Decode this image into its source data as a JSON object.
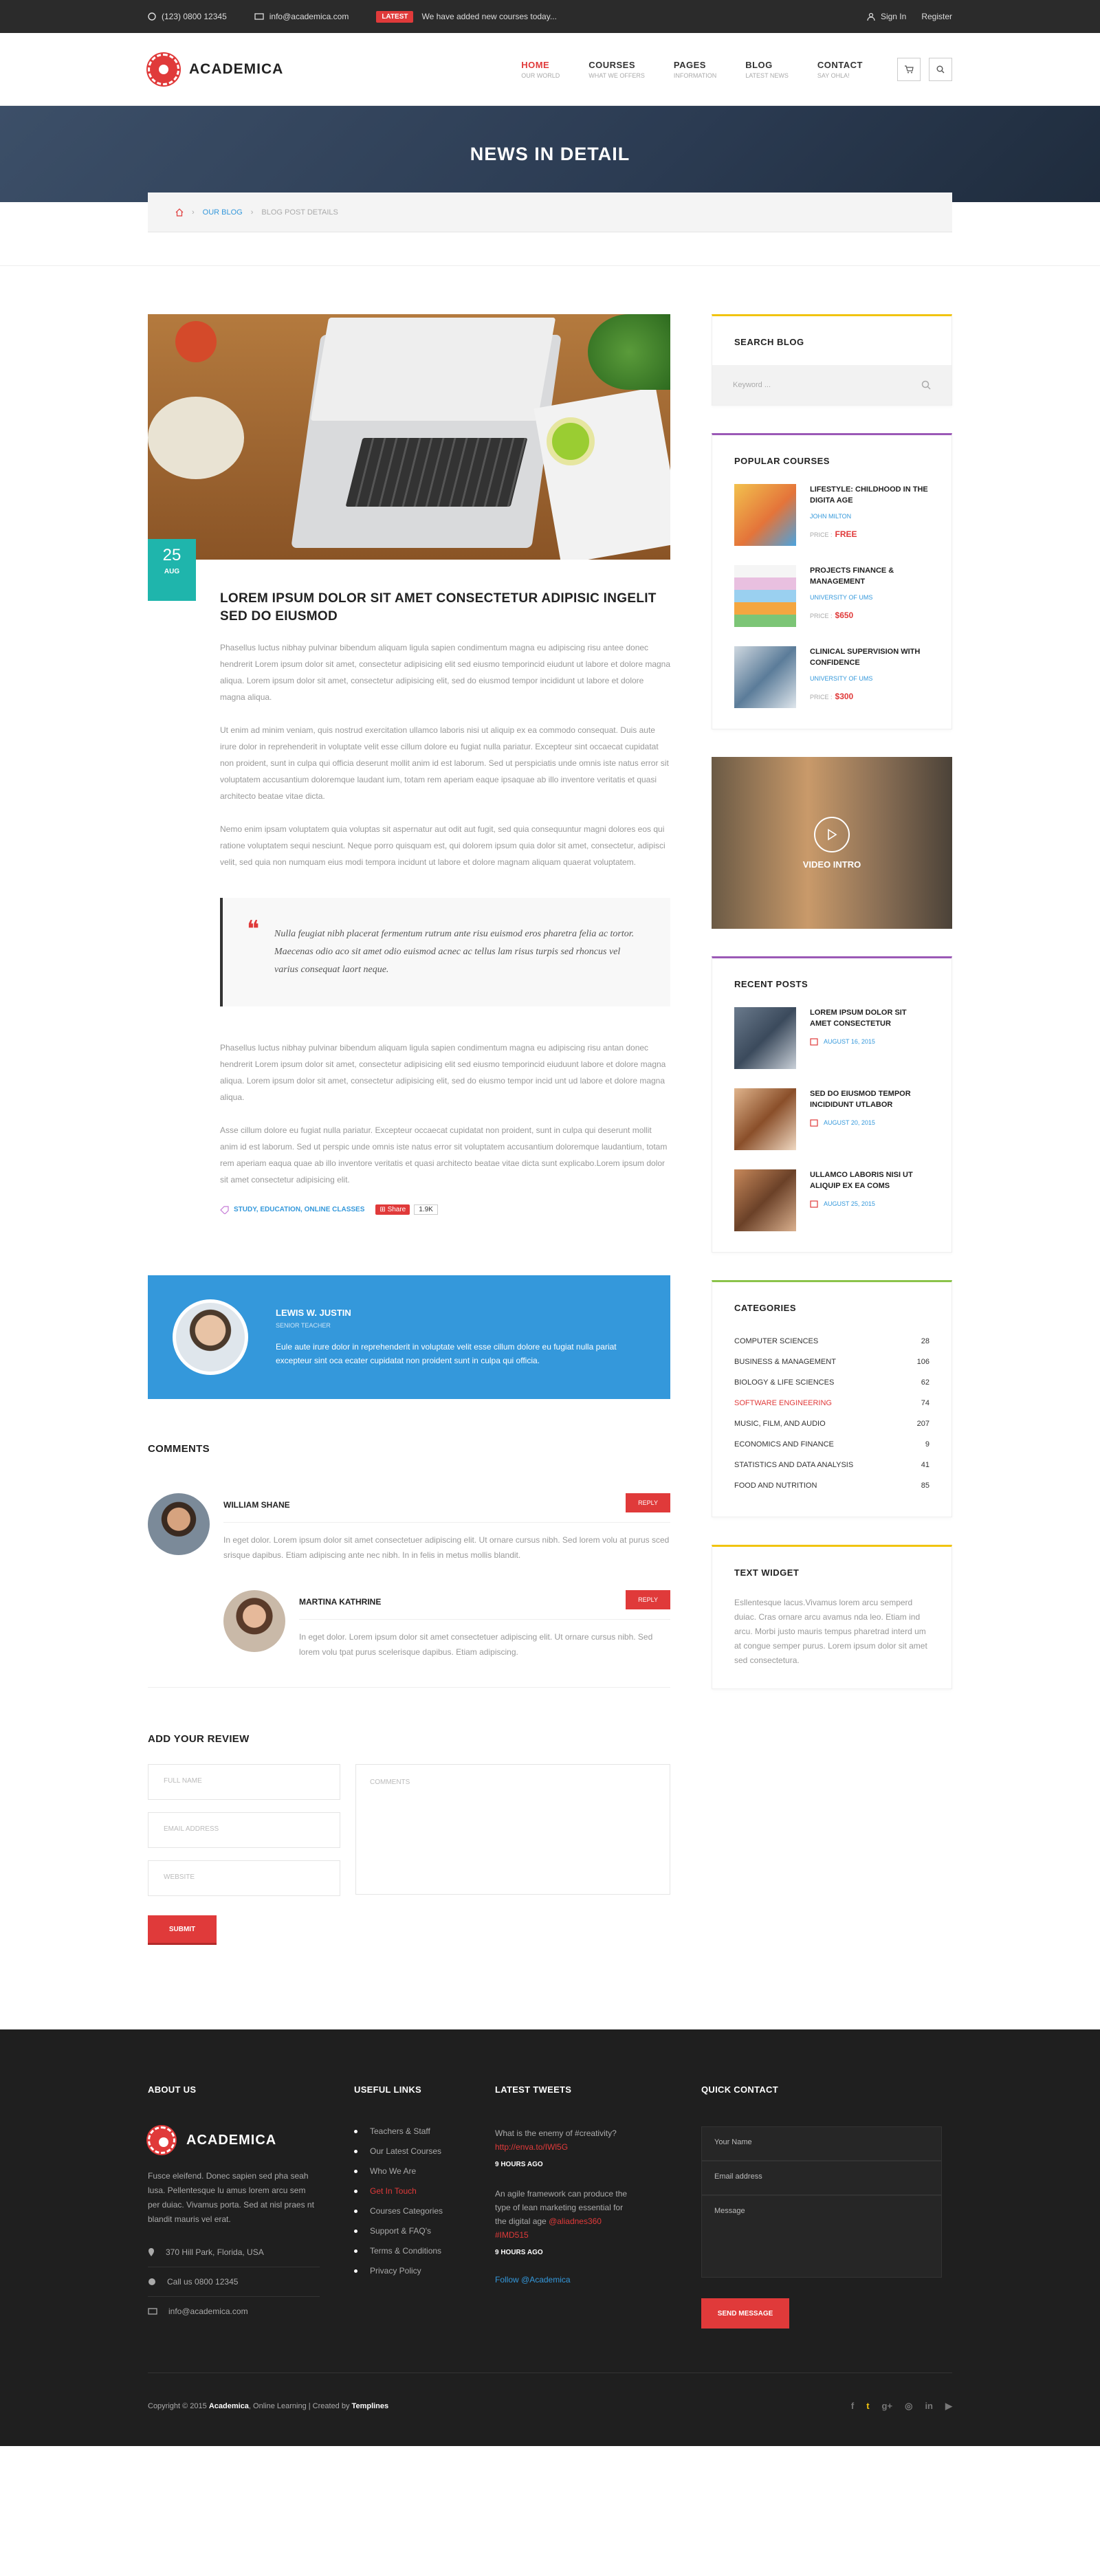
{
  "topbar": {
    "phone": "(123) 0800 12345",
    "email": "info@academica.com",
    "latest_badge": "LATEST",
    "latest_text": "We have added new courses today...",
    "sign_in": "Sign In",
    "register": "Register"
  },
  "brand": {
    "name": "ACADEMICA",
    "accent": "#e03a3a",
    "blue": "#3498db",
    "teal": "#1fb5ac"
  },
  "nav": [
    {
      "label": "HOME",
      "sub": "OUR WORLD"
    },
    {
      "label": "COURSES",
      "sub": "WHAT WE OFFERS"
    },
    {
      "label": "PAGES",
      "sub": "INFORMATION"
    },
    {
      "label": "BLOG",
      "sub": "LATEST NEWS"
    },
    {
      "label": "CONTACT",
      "sub": "SAY OHLA!"
    }
  ],
  "banner": {
    "title": "NEWS IN DETAIL"
  },
  "breadcrumb": {
    "blog": "OUR BLOG",
    "current": "BLOG POST DETAILS"
  },
  "post": {
    "day": "25",
    "month": "AUG",
    "title": "LOREM IPSUM DOLOR SIT AMET CONSECTETUR ADIPISIC INGELIT SED DO EIUSMOD",
    "p1": "Phasellus luctus nibhay pulvinar bibendum aliquam ligula sapien condimentum magna eu adipiscing risu antee donec hendrerit Lorem ipsum dolor sit amet, consectetur adipisicing elit sed eiusmo temporincid eiudunt ut labore et dolore magna aliqua. Lorem ipsum dolor sit amet, consectetur adipisicing elit, sed do eiusmod tempor incididunt ut labore et dolore magna aliqua.",
    "p2": "Ut enim ad minim veniam, quis nostrud exercitation ullamco laboris nisi ut aliquip ex ea commodo consequat. Duis aute irure dolor in reprehenderit in voluptate velit esse cillum dolore eu fugiat nulla pariatur. Excepteur sint occaecat cupidatat non proident, sunt in culpa qui officia deserunt mollit anim id est laborum. Sed ut perspiciatis unde omnis iste natus error sit voluptatem accusantium doloremque laudant ium, totam rem aperiam eaque ipsaquae ab illo inventore veritatis et quasi architecto beatae vitae dicta.",
    "p3": "Nemo enim ipsam voluptatem quia voluptas sit aspernatur aut odit aut fugit, sed quia consequuntur magni dolores eos qui ratione voluptatem sequi nesciunt. Neque porro quisquam est, qui dolorem ipsum quia dolor sit amet, consectetur, adipisci velit, sed quia non numquam eius modi tempora incidunt ut labore et dolore magnam aliquam quaerat voluptatem.",
    "quote": "Nulla feugiat nibh placerat fermentum rutrum ante risu euismod eros pharetra felia ac tortor. Maecenas odio aco sit amet odio euismod acnec ac tellus lam risus turpis sed rhoncus vel varius consequat laort neque.",
    "p4": "Phasellus luctus nibhay pulvinar bibendum aliquam ligula sapien condimentum magna eu adipiscing risu antan donec hendrerit Lorem ipsum dolor sit amet, consectetur adipisicing elit sed eiusmo temporincid eiuduunt labore et dolore magna aliqua. Lorem ipsum dolor sit amet, consectetur adipisicing elit, sed do eiusmo tempor incid unt ud labore et dolore magna aliqua.",
    "p5": "Asse cillum dolore eu fugiat nulla pariatur. Excepteur occaecat cupidatat non proident, sunt in culpa qui deserunt mollit anim id est laborum. Sed ut perspic unde omnis iste natus error sit voluptatem accusantium doloremque laudantium, totam rem aperiam eaqua quae ab illo inventore veritatis et quasi architecto beatae vitae dicta sunt explicabo.Lorem ipsum dolor sit amet consectetur adipisicing elit.",
    "tags": "STUDY, EDUCATION, ONLINE CLASSES",
    "share_label": "Share",
    "share_count": "1.9K"
  },
  "author": {
    "name": "LEWIS W. JUSTIN",
    "role": "SENIOR TEACHER",
    "bio": "Eule aute irure dolor in reprehenderit in voluptate velit esse cillum dolore eu fugiat nulla pariat excepteur sint oca ecater cupidatat non proident sunt in culpa qui officia."
  },
  "comments": {
    "heading": "COMMENTS",
    "items": [
      {
        "name": "WILLIAM SHANE",
        "reply": "REPLY",
        "text": "In eget dolor. Lorem ipsum dolor sit amet consectetuer adipiscing elit. Ut ornare cursus nibh. Sed lorem volu at purus sced srisque dapibus. Etiam adipiscing ante nec nibh. In in felis in metus mollis blandit."
      },
      {
        "name": "MARTINA KATHRINE",
        "reply": "REPLY",
        "text": "In eget dolor. Lorem ipsum dolor sit amet consectetuer adipiscing elit. Ut ornare cursus nibh. Sed lorem volu tpat purus scelerisque dapibus. Etiam adipiscing."
      }
    ]
  },
  "review": {
    "heading": "ADD YOUR REVIEW",
    "full_name": "FULL NAME",
    "email": "EMAIL ADDRESS",
    "website": "WEBSITE",
    "comments": "COMMENTS",
    "submit": "SUBMIT"
  },
  "sidebar": {
    "search": {
      "title": "SEARCH BLOG",
      "placeholder": "Keyword ..."
    },
    "popular": {
      "title": "POPULAR COURSES",
      "price_label": "PRICE :",
      "items": [
        {
          "title": "LIFESTYLE: CHILDHOOD IN THE DIGITA AGE",
          "sub": "JOHN MILTON",
          "price": "FREE"
        },
        {
          "title": "PROJECTS FINANCE & MANAGEMENT",
          "sub": "UNIVERSITY OF UMS",
          "price": "$650"
        },
        {
          "title": "CLINICAL SUPERVISION WITH CONFIDENCE",
          "sub": "UNIVERSITY OF UMS",
          "price": "$300"
        }
      ]
    },
    "video": {
      "title": "VIDEO INTRO"
    },
    "recent": {
      "title": "RECENT POSTS",
      "items": [
        {
          "title": "LOREM IPSUM DOLOR SIT AMET CONSECTETUR",
          "date": "AUGUST 16, 2015"
        },
        {
          "title": "SED DO EIUSMOD TEMPOR INCIDIDUNT UTLABOR",
          "date": "AUGUST 20, 2015"
        },
        {
          "title": "ULLAMCO LABORIS NISI UT ALIQUIP EX EA COMS",
          "date": "AUGUST 25, 2015"
        }
      ]
    },
    "categories": {
      "title": "CATEGORIES",
      "items": [
        {
          "name": "COMPUTER SCIENCES",
          "count": "28"
        },
        {
          "name": "BUSINESS & MANAGEMENT",
          "count": "106"
        },
        {
          "name": "BIOLOGY & LIFE SCIENCES",
          "count": "62"
        },
        {
          "name": "SOFTWARE ENGINEERING",
          "count": "74"
        },
        {
          "name": "MUSIC, FILM, AND AUDIO",
          "count": "207"
        },
        {
          "name": "ECONOMICS AND FINANCE",
          "count": "9"
        },
        {
          "name": "STATISTICS AND DATA ANALYSIS",
          "count": "41"
        },
        {
          "name": "FOOD AND NUTRITION",
          "count": "85"
        }
      ]
    },
    "text_widget": {
      "title": "TEXT WIDGET",
      "text": "Esllentesque lacus.Vivamus lorem arcu semperd duiac. Cras ornare arcu avamus nda leo. Etiam ind arcu. Morbi justo mauris tempus pharetrad interd um at congue semper purus. Lorem ipsum dolor sit amet sed consectetura."
    }
  },
  "footer": {
    "about": {
      "title": "ABOUT US",
      "text": "Fusce eleifend. Donec sapien sed pha seah lusa. Pellentesque lu amus lorem arcu sem per duiac. Vivamus porta. Sed at nisl praes nt blandit mauris vel erat.",
      "address": "370 Hill Park, Florida, USA",
      "phone": "Call us 0800 12345",
      "email": "info@academica.com"
    },
    "links": {
      "title": "USEFUL LINKS",
      "items": [
        "Teachers & Staff",
        "Our Latest Courses",
        "Who We Are",
        "Get In Touch",
        "Courses Categories",
        "Support & FAQ's",
        "Terms & Conditions",
        "Privacy Policy"
      ]
    },
    "tweets": {
      "title": "LATEST TWEETS",
      "items": [
        {
          "text": "What is the enemy of #creativity?",
          "link": "http://enva.to/IWl5G",
          "ago": "9 HOURS AGO"
        },
        {
          "text": "An agile framework can produce the type of lean marketing essential for the digital age",
          "link": "@aliadnes360 #IMD515",
          "ago": "9 HOURS AGO"
        }
      ],
      "follow": "Follow @Academica"
    },
    "quick": {
      "title": "QUICK CONTACT",
      "name": "Your Name",
      "email": "Email address",
      "message": "Message",
      "send": "SEND MESSAGE"
    },
    "copyright_pre": "Copyright © 2015",
    "copyright_brand": "Academica",
    "copyright_mid": ", Online Learning  |  Created by",
    "copyright_by": "Templines",
    "socials": [
      "f",
      "t",
      "g+",
      "◎",
      "in",
      "▶"
    ]
  }
}
